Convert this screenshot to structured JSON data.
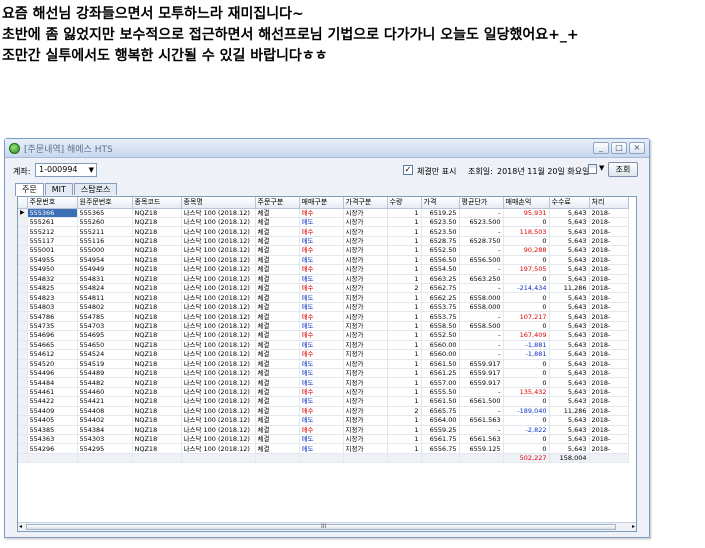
{
  "post": {
    "lines": [
      "요즘 해선님 강좌들으면서 모투하느라 재미집니다~",
      "초반에 좀 잃었지만 보수적으로 접근하면서 해선프로님 기법으로 다가가니 오늘도 일당했어요+_+",
      "조만간 실투에서도 행복한 시간될 수 있길 바랍니다ㅎㅎ"
    ]
  },
  "window": {
    "title": "[주문내역] 해에스 HTS",
    "buttons": [
      "_",
      "□",
      "×"
    ]
  },
  "toolbar": {
    "account_label": "계좌:",
    "account_value": "1-000994",
    "filter_checkbox_mark": "✓",
    "filter_label": "체결만 표시",
    "date_label": "조회일:",
    "date_value": "2018년 11월 20일 화요일",
    "query_button": "조회"
  },
  "tabs": [
    "주문",
    "MIT",
    "스탑로스"
  ],
  "table": {
    "columns": [
      "주문번호",
      "원주문번호",
      "종목코드",
      "종목명",
      "주문구분",
      "매매구분",
      "가격구분",
      "수량",
      "가격",
      "평균단가",
      "매매손익",
      "수수료",
      "처리"
    ],
    "rows": [
      [
        "555366",
        "555365",
        "NQZ18",
        "나스닥 100 (2018.12)",
        "체결",
        "매수",
        "시장가",
        "1",
        "6519.25",
        "-",
        "95,931",
        "5,643",
        "2018-"
      ],
      [
        "555261",
        "555260",
        "NQZ18",
        "나스닥 100 (2018.12)",
        "체결",
        "매도",
        "시장가",
        "1",
        "6523.50",
        "6523.500",
        "0",
        "5,643",
        "2018-"
      ],
      [
        "555212",
        "555211",
        "NQZ18",
        "나스닥 100 (2018.12)",
        "체결",
        "매수",
        "시장가",
        "1",
        "6523.50",
        "-",
        "118,503",
        "5,643",
        "2018-"
      ],
      [
        "555117",
        "555116",
        "NQZ18",
        "나스닥 100 (2018.12)",
        "체결",
        "매도",
        "시장가",
        "1",
        "6528.75",
        "6528.750",
        "0",
        "5,643",
        "2018-"
      ],
      [
        "555001",
        "555000",
        "NQZ18",
        "나스닥 100 (2018.12)",
        "체결",
        "매수",
        "시장가",
        "1",
        "6552.50",
        "-",
        "90,288",
        "5,643",
        "2018-"
      ],
      [
        "554955",
        "554954",
        "NQZ18",
        "나스닥 100 (2018.12)",
        "체결",
        "매도",
        "시장가",
        "1",
        "6556.50",
        "6556.500",
        "0",
        "5,643",
        "2018-"
      ],
      [
        "554950",
        "554949",
        "NQZ18",
        "나스닥 100 (2018.12)",
        "체결",
        "매수",
        "시장가",
        "1",
        "6554.50",
        "-",
        "197,505",
        "5,643",
        "2018-"
      ],
      [
        "554832",
        "554831",
        "NQZ18",
        "나스닥 100 (2018.12)",
        "체결",
        "매도",
        "시장가",
        "1",
        "6563.25",
        "6563.250",
        "0",
        "5,643",
        "2018-"
      ],
      [
        "554825",
        "554824",
        "NQZ18",
        "나스닥 100 (2018.12)",
        "체결",
        "매수",
        "시장가",
        "2",
        "6562.75",
        "-",
        "-214,434",
        "11,286",
        "2018-"
      ],
      [
        "554823",
        "554811",
        "NQZ18",
        "나스닥 100 (2018.12)",
        "체결",
        "매도",
        "지정가",
        "1",
        "6562.25",
        "6558.000",
        "0",
        "5,643",
        "2018-"
      ],
      [
        "554803",
        "554802",
        "NQZ18",
        "나스닥 100 (2018.12)",
        "체결",
        "매도",
        "시장가",
        "1",
        "6553.75",
        "6558.000",
        "0",
        "5,643",
        "2018-"
      ],
      [
        "554786",
        "554785",
        "NQZ18",
        "나스닥 100 (2018.12)",
        "체결",
        "매수",
        "시장가",
        "1",
        "6553.75",
        "-",
        "107,217",
        "5,643",
        "2018-"
      ],
      [
        "554735",
        "554703",
        "NQZ18",
        "나스닥 100 (2018.12)",
        "체결",
        "매도",
        "지정가",
        "1",
        "6558.50",
        "6558.500",
        "0",
        "5,643",
        "2018-"
      ],
      [
        "554696",
        "554695",
        "NQZ18",
        "나스닥 100 (2018.12)",
        "체결",
        "매수",
        "시장가",
        "1",
        "6552.50",
        "-",
        "167,409",
        "5,643",
        "2018-"
      ],
      [
        "554665",
        "554650",
        "NQZ18",
        "나스닥 100 (2018.12)",
        "체결",
        "매도",
        "지정가",
        "1",
        "6560.00",
        "-",
        "-1,881",
        "5,643",
        "2018-"
      ],
      [
        "554612",
        "554524",
        "NQZ18",
        "나스닥 100 (2018.12)",
        "체결",
        "매수",
        "지정가",
        "1",
        "6560.00",
        "-",
        "-1,881",
        "5,643",
        "2018-"
      ],
      [
        "554520",
        "554519",
        "NQZ18",
        "나스닥 100 (2018.12)",
        "체결",
        "매도",
        "시장가",
        "1",
        "6561.50",
        "6559.917",
        "0",
        "5,643",
        "2018-"
      ],
      [
        "554496",
        "554489",
        "NQZ18",
        "나스닥 100 (2018.12)",
        "체결",
        "매도",
        "지정가",
        "1",
        "6561.25",
        "6559.917",
        "0",
        "5,643",
        "2018-"
      ],
      [
        "554484",
        "554482",
        "NQZ18",
        "나스닥 100 (2018.12)",
        "체결",
        "매도",
        "지정가",
        "1",
        "6557.00",
        "6559.917",
        "0",
        "5,643",
        "2018-"
      ],
      [
        "554461",
        "554460",
        "NQZ18",
        "나스닥 100 (2018.12)",
        "체결",
        "매수",
        "시장가",
        "1",
        "6555.50",
        "-",
        "135,432",
        "5,643",
        "2018-"
      ],
      [
        "554422",
        "554421",
        "NQZ18",
        "나스닥 100 (2018.12)",
        "체결",
        "매도",
        "시장가",
        "1",
        "6561.50",
        "6561.500",
        "0",
        "5,643",
        "2018-"
      ],
      [
        "554409",
        "554408",
        "NQZ18",
        "나스닥 100 (2018.12)",
        "체결",
        "매수",
        "시장가",
        "2",
        "6565.75",
        "-",
        "-189,040",
        "11,286",
        "2018-"
      ],
      [
        "554405",
        "554402",
        "NQZ18",
        "나스닥 100 (2018.12)",
        "체결",
        "매도",
        "지정가",
        "1",
        "6564.00",
        "6561.563",
        "0",
        "5,643",
        "2018-"
      ],
      [
        "554385",
        "554384",
        "NQZ18",
        "나스닥 100 (2018.12)",
        "체결",
        "매수",
        "지정가",
        "1",
        "6559.25",
        "-",
        "-2,822",
        "5,643",
        "2018-"
      ],
      [
        "554363",
        "554303",
        "NQZ18",
        "나스닥 100 (2018.12)",
        "체결",
        "매도",
        "시장가",
        "1",
        "6561.75",
        "6561.563",
        "0",
        "5,643",
        "2018-"
      ],
      [
        "554296",
        "554295",
        "NQZ18",
        "나스닥 100 (2018.12)",
        "체결",
        "매도",
        "지정가",
        "1",
        "6556.75",
        "6559.125",
        "0",
        "5,643",
        "2018-"
      ]
    ],
    "totals": {
      "pnl": "502,227",
      "fee": "158,004"
    },
    "selected_row": 0,
    "row_marker": "▶",
    "scroll_grip": "III",
    "scroll_left": "◂",
    "scroll_right": "▸"
  },
  "colors": {
    "buy": "#e00000",
    "sell": "#0a32c8",
    "loss": "#0a32c8",
    "profit": "#e00000"
  }
}
